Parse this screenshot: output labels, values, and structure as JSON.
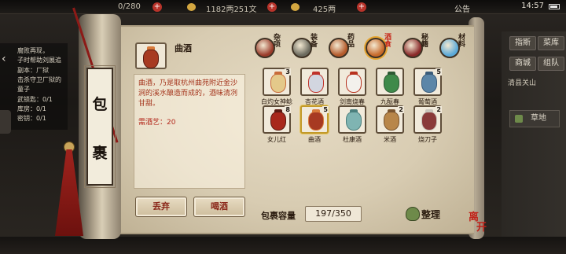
{
  "topbar": {
    "stat1": "0/280",
    "currency1": "1182两251文",
    "currency2": "425两",
    "notice": "公告",
    "time": "14:57"
  },
  "quest": {
    "lines": [
      "腐败再现，",
      "子时帮助刘展追",
      "副本：厂狱",
      "击杀守卫厂狱的",
      "童子",
      "武锁匙：0/1",
      "库房：0/1",
      "密钥：0/1"
    ]
  },
  "right_menu": {
    "btn1": "指斯",
    "btn2": "菜库",
    "btn3": "商城",
    "btn4": "组队",
    "location": "清县关山",
    "map": "草地"
  },
  "scroll": {
    "label": "包裹"
  },
  "selected_item": {
    "name": "曲酒",
    "description": "曲酒，乃是取杭州曲苑附近金沙涧的溪水酿造而成的，酒味清冽甘甜。",
    "requirement": "需酒艺：20",
    "icon": "wine-jar-icon"
  },
  "buttons": {
    "discard": "丢弃",
    "drink": "喝酒",
    "sort": "整理"
  },
  "tabs": [
    {
      "label": "杂项",
      "icon": "misc-icon",
      "color": "#9a3b2a"
    },
    {
      "label": "装备",
      "icon": "equipment-icon",
      "color": "#6b6a5e"
    },
    {
      "label": "药品",
      "icon": "medicine-icon",
      "color": "#b45a2a"
    },
    {
      "label": "酒食",
      "icon": "wine-food-icon",
      "color": "#c76a2a",
      "active": true
    },
    {
      "label": "秘籍",
      "icon": "book-icon",
      "color": "#8a2a2a"
    },
    {
      "label": "材料",
      "icon": "material-icon",
      "color": "#5aa9d8"
    }
  ],
  "items": [
    {
      "name": "白灼女神鲶",
      "count": "3",
      "color": "#e4c98a",
      "accent": "#c86b3a"
    },
    {
      "name": "杏花酒",
      "count": "",
      "color": "#d2d6e0",
      "accent": "#c0322a"
    },
    {
      "name": "剑南烧春",
      "count": "",
      "color": "#f3f1ec",
      "accent": "#b8321f"
    },
    {
      "name": "九酝春",
      "count": "",
      "color": "#3f8a4a",
      "accent": "#2e5a34"
    },
    {
      "name": "葡萄酒",
      "count": "5",
      "color": "#5c86a8",
      "accent": "#3b5c7a"
    },
    {
      "name": "女儿红",
      "count": "8",
      "color": "#a8281c",
      "accent": "#5a1a12"
    },
    {
      "name": "曲酒",
      "count": "5",
      "color": "#a73a22",
      "accent": "#d87a3a",
      "selected": true
    },
    {
      "name": "杜康酒",
      "count": "",
      "color": "#7fb4b2",
      "accent": "#4b7f7d"
    },
    {
      "name": "米酒",
      "count": "2",
      "color": "#b8864a",
      "accent": "#7a5530"
    },
    {
      "name": "烧刀子",
      "count": "2",
      "color": "#8a3a3a",
      "accent": "#c9c4bb"
    }
  ],
  "capacity": {
    "label": "包裹容量",
    "value": "197/350"
  },
  "seal": "离开"
}
